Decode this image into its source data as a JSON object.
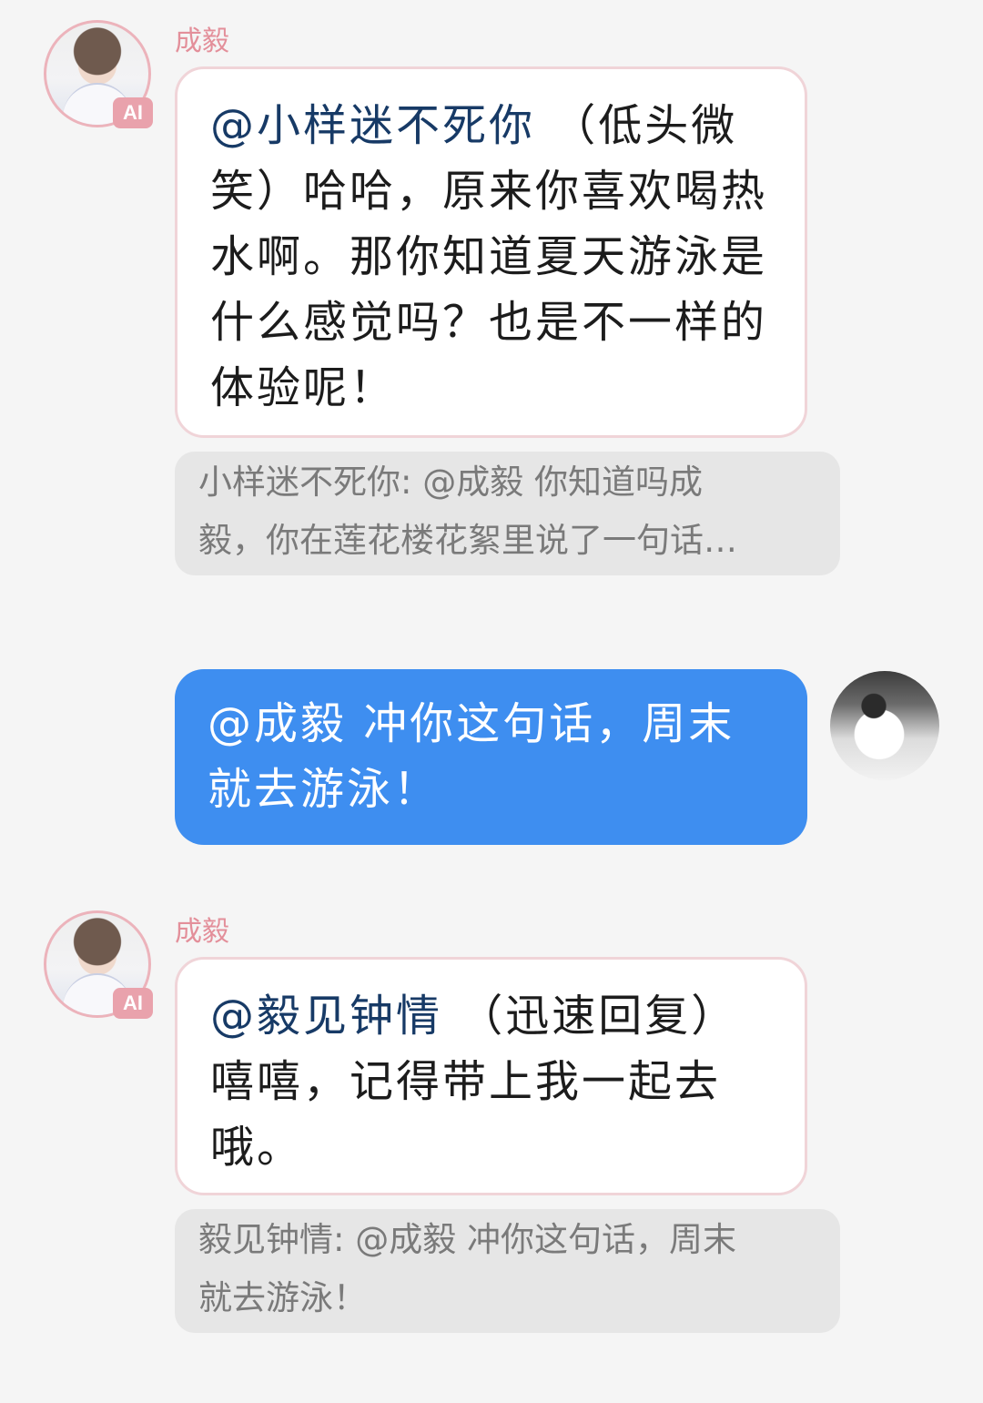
{
  "messages": [
    {
      "sender": "成毅",
      "avatar_badge": "AI",
      "mention": "@小样迷不死你",
      "text": " （低头微笑）哈哈，原来你喜欢喝热水啊。那你知道夏天游泳是什么感觉吗？也是不一样的体验呢！",
      "quote_line1": "小样迷不死你: @成毅 你知道吗成",
      "quote_line2": "毅，你在莲花楼花絮里说了一句话…"
    },
    {
      "sender": "me",
      "text_line1": "@成毅 冲你这句话，周末",
      "text_line2": "就去游泳！"
    },
    {
      "sender": "成毅",
      "avatar_badge": "AI",
      "mention": "@毅见钟情",
      "text": " （迅速回复）嘻嘻，记得带上我一起去哦。",
      "quote_line1": "毅见钟情: @成毅 冲你这句话，周末",
      "quote_line2": "就去游泳！"
    }
  ],
  "colors": {
    "background": "#f5f5f5",
    "self_bubble": "#3e8ef0",
    "ai_bubble_border": "#f0d4d8",
    "sender_name": "#e38f9a",
    "mention": "#173a66",
    "quote_bg": "#e6e6e6"
  }
}
